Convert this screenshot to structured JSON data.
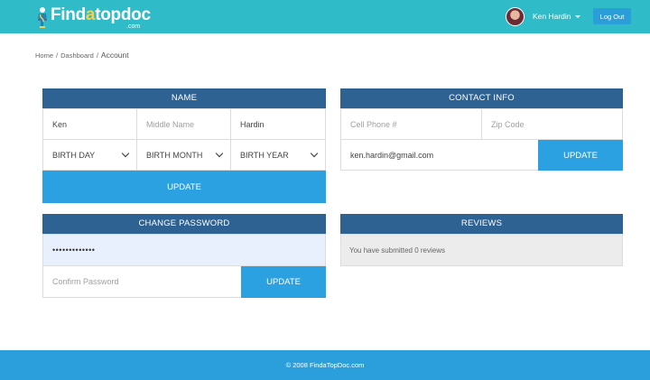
{
  "header": {
    "logo": {
      "part1": "Find",
      "part2": "a",
      "part3": "topdoc",
      "sub": ".com"
    },
    "user_name": "Ken Hardin",
    "logout_label": "Log Out"
  },
  "breadcrumb": {
    "home": "Home",
    "dashboard": "Dashboard",
    "current": "Account",
    "separator": "/"
  },
  "name_panel": {
    "title": "NAME",
    "first_name": "Ken",
    "middle_name_placeholder": "Middle Name",
    "last_name": "Hardin",
    "birth_day": "BIRTH DAY",
    "birth_month": "BIRTH MONTH",
    "birth_year": "BIRTH YEAR",
    "update_label": "UPDATE"
  },
  "contact_panel": {
    "title": "CONTACT INFO",
    "cell_phone_placeholder": "Cell Phone #",
    "zip_placeholder": "Zip Code",
    "email": "ken.hardin@gmail.com",
    "update_label": "UPDATE"
  },
  "password_panel": {
    "title": "CHANGE PASSWORD",
    "password_mask": "•••••••••••••",
    "confirm_placeholder": "Confirm Password",
    "update_label": "UPDATE"
  },
  "reviews_panel": {
    "title": "REVIEWS",
    "message": "You have submitted 0 reviews"
  },
  "footer": {
    "copyright": "© 2008 FindaTopDoc.com"
  },
  "colors": {
    "header_bg": "#2fbcc8",
    "panel_header": "#2e6293",
    "button": "#2ba1e2",
    "footer_bg": "#2a9fdc",
    "logo_accent": "#f2d34b"
  },
  "icons": {
    "logo": "doctor-logo-icon",
    "caret": "caret-down-icon",
    "select": "chevron-down-icon"
  }
}
